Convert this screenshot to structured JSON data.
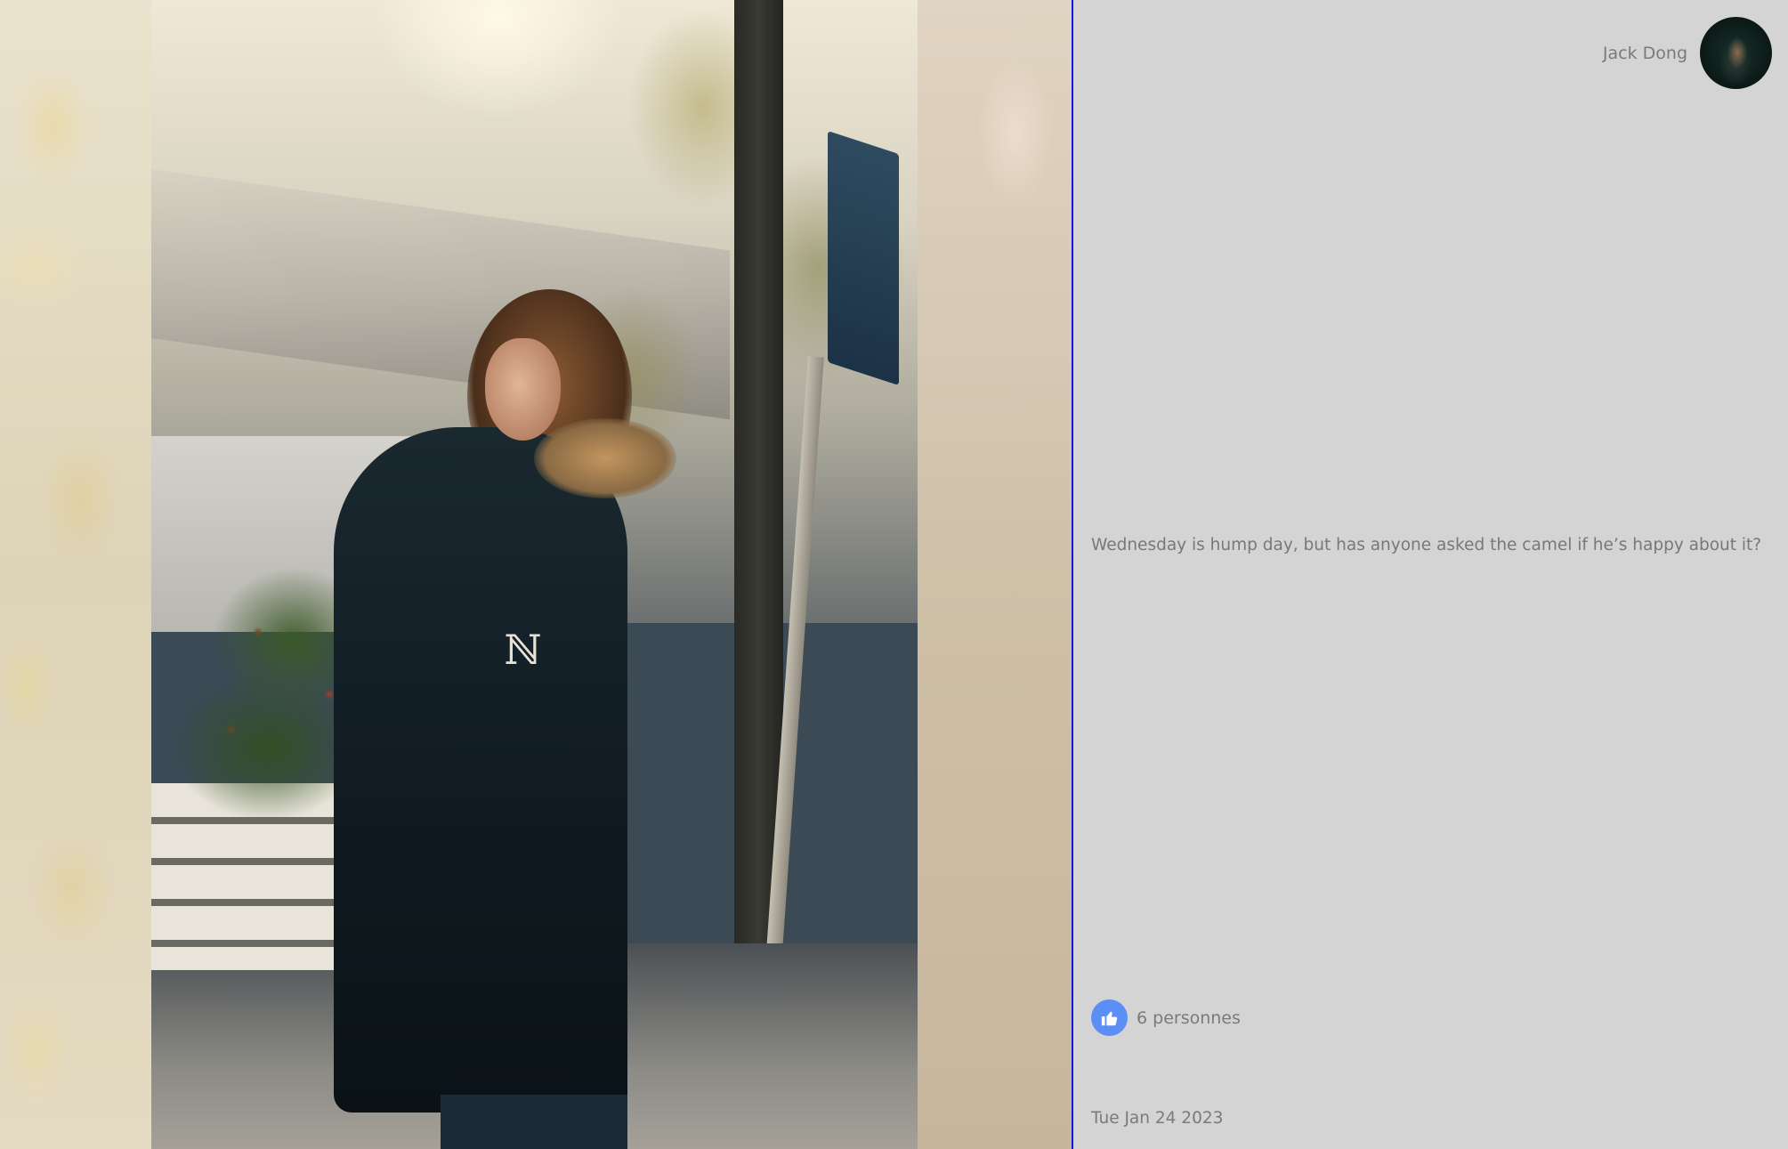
{
  "post": {
    "author_name": "Jack Dong",
    "text": "Wednesday is hump day, but has anyone asked the camel if he’s happy about it?",
    "likes_label": "6 personnes",
    "date": "Tue Jan 24 2023"
  },
  "icons": {
    "like": "thumbs-up-icon",
    "avatar": "avatar"
  },
  "colors": {
    "panel_bg": "#d4d4d4",
    "divider": "#1414e6",
    "like_badge": "#5b8ff5",
    "text": "#787878"
  }
}
